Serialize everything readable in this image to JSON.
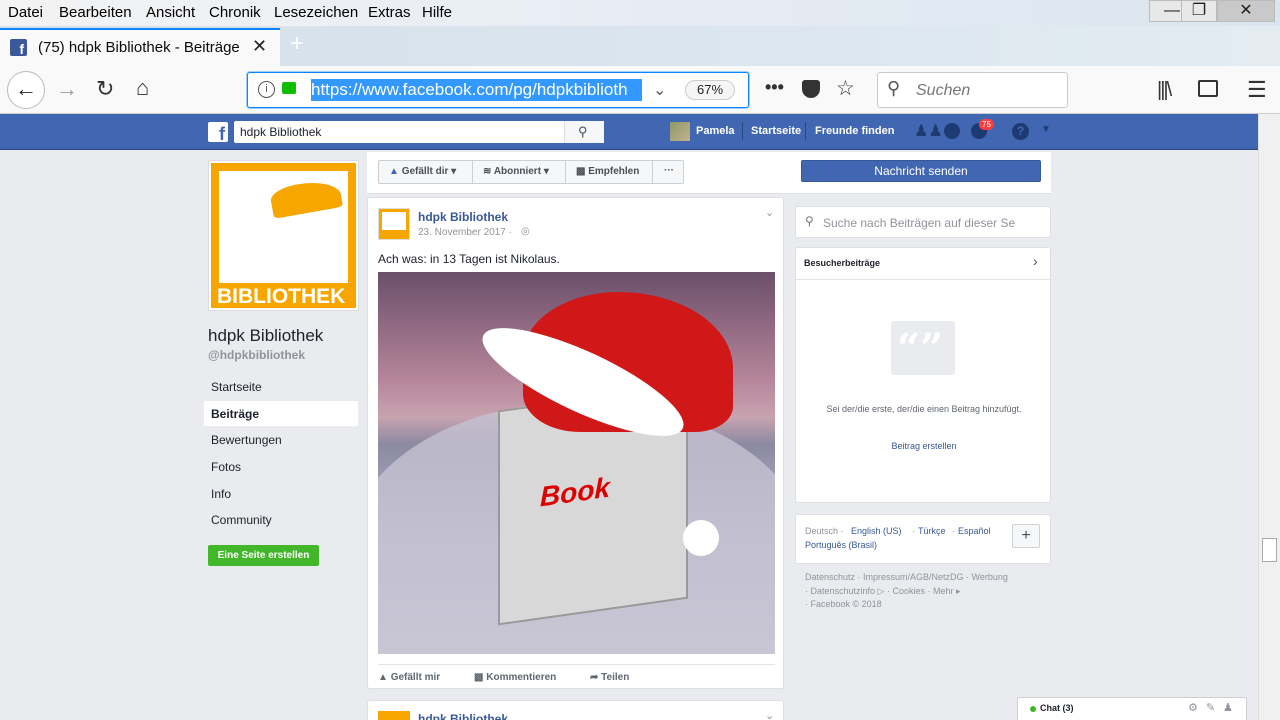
{
  "menu": [
    "Datei",
    "Bearbeiten",
    "Ansicht",
    "Chronik",
    "Lesezeichen",
    "Extras",
    "Hilfe"
  ],
  "menu_underline": [
    "D",
    "B",
    "A",
    "C",
    "L",
    "E",
    "H"
  ],
  "tab": {
    "title": "(75) hdpk Bibliothek - Beiträge",
    "new_tab": "+"
  },
  "url": {
    "value": "https://www.facebook.com/pg/hdpkbiblioth",
    "zoom": "67%"
  },
  "search": {
    "placeholder": "Suchen"
  },
  "fb": {
    "search_value": "hdpk Bibliothek",
    "user": "Pamela",
    "home": "Startseite",
    "find_friends": "Freunde finden",
    "notif_count": "75"
  },
  "page": {
    "logo_text": "BIBLIOTHEK",
    "name": "hdpk Bibliothek",
    "handle": "@hdpkbibliothek",
    "nav": [
      "Startseite",
      "Beiträge",
      "Bewertungen",
      "Fotos",
      "Info",
      "Community"
    ],
    "active_nav": "Beiträge",
    "create_page": "Eine Seite erstellen"
  },
  "actions": {
    "like": "Gefällt dir",
    "follow": "Abonniert",
    "recommend": "Empfehlen",
    "more": "···",
    "message": "Nachricht senden"
  },
  "post": {
    "author": "hdpk Bibliothek",
    "date": "23. November 2017 ·",
    "text": "Ach was: in 13 Tagen ist Nikolaus.",
    "image_word": "Book",
    "like": "Gefällt mir",
    "comment": "Kommentieren",
    "share": "Teilen"
  },
  "post2_author": "hdpk Bibliothek",
  "right": {
    "search_placeholder": "Suche nach Beiträgen auf dieser Se",
    "visitor_title": "Besucherbeiträge",
    "empty_text": "Sei der/die erste, der/die einen Beitrag hinzufügt.",
    "create_post": "Beitrag erstellen",
    "languages": {
      "current": "Deutsch ·",
      "others": [
        "English (US)",
        "Türkçe",
        "Español",
        "Português (Brasil)"
      ]
    },
    "footer": [
      "Datenschutz · Impressum/AGB/NetzDG · Werbung",
      "· Datenschutzinfo ▷ · Cookies · Mehr ▸",
      "· Facebook © 2018"
    ]
  },
  "chat": {
    "label": "Chat (3)"
  }
}
